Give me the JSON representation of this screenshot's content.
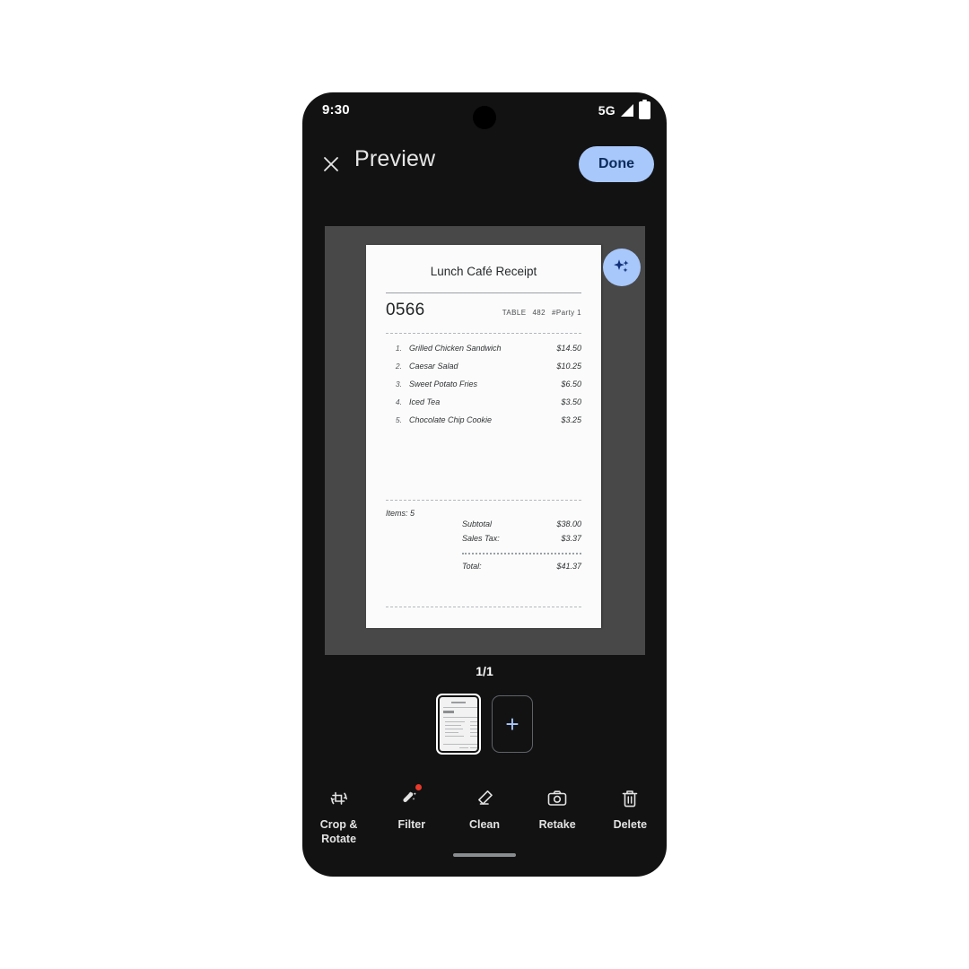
{
  "status_bar": {
    "time": "9:30",
    "network": "5G",
    "signal_icon": "signal-bars-icon",
    "battery_icon": "battery-full-icon",
    "camera_icon": "front-camera-punch-hole"
  },
  "app_bar": {
    "close_icon": "close-x-icon",
    "title": "Preview",
    "done_label": "Done",
    "done_bg": "#a8c7fa",
    "done_text_color": "#0b2b5c"
  },
  "viewer": {
    "background": "#484848",
    "enhance_icon": "sparkle-magic-icon",
    "enhance_bg": "#a8c7fa"
  },
  "document": {
    "title": "Lunch Café Receipt",
    "order_number": "0566",
    "meta": [
      "TABLE",
      "482",
      "#Party 1"
    ],
    "items": [
      {
        "index": "1.",
        "name": "Grilled Chicken Sandwich",
        "price": "$14.50"
      },
      {
        "index": "2.",
        "name": "Caesar Salad",
        "price": "$10.25"
      },
      {
        "index": "3.",
        "name": "Sweet Potato Fries",
        "price": "$6.50"
      },
      {
        "index": "4.",
        "name": "Iced Tea",
        "price": "$3.50"
      },
      {
        "index": "5.",
        "name": "Chocolate Chip Cookie",
        "price": "$3.25"
      }
    ],
    "items_count": "Items: 5",
    "totals": [
      {
        "label": "Subtotal",
        "value": "$38.00"
      },
      {
        "label": "Sales Tax:",
        "value": "$3.37"
      }
    ],
    "grand_total": {
      "label": "Total:",
      "value": "$41.37"
    }
  },
  "pages": {
    "indicator": "1/1",
    "thumbnail_name": "page-1-thumbnail",
    "add_label": "+"
  },
  "toolbar": {
    "items": [
      {
        "label": "Crop &\nRotate",
        "icon": "crop-rotate-icon",
        "badge": false
      },
      {
        "label": "Filter",
        "icon": "magic-wand-filter-icon",
        "badge": true
      },
      {
        "label": "Clean",
        "icon": "eraser-clean-icon",
        "badge": false
      },
      {
        "label": "Retake",
        "icon": "camera-retake-icon",
        "badge": false
      },
      {
        "label": "Delete",
        "icon": "trash-delete-icon",
        "badge": false
      }
    ],
    "badge_color": "#e8392b"
  },
  "nav": {
    "handle": "gesture-nav-handle"
  }
}
